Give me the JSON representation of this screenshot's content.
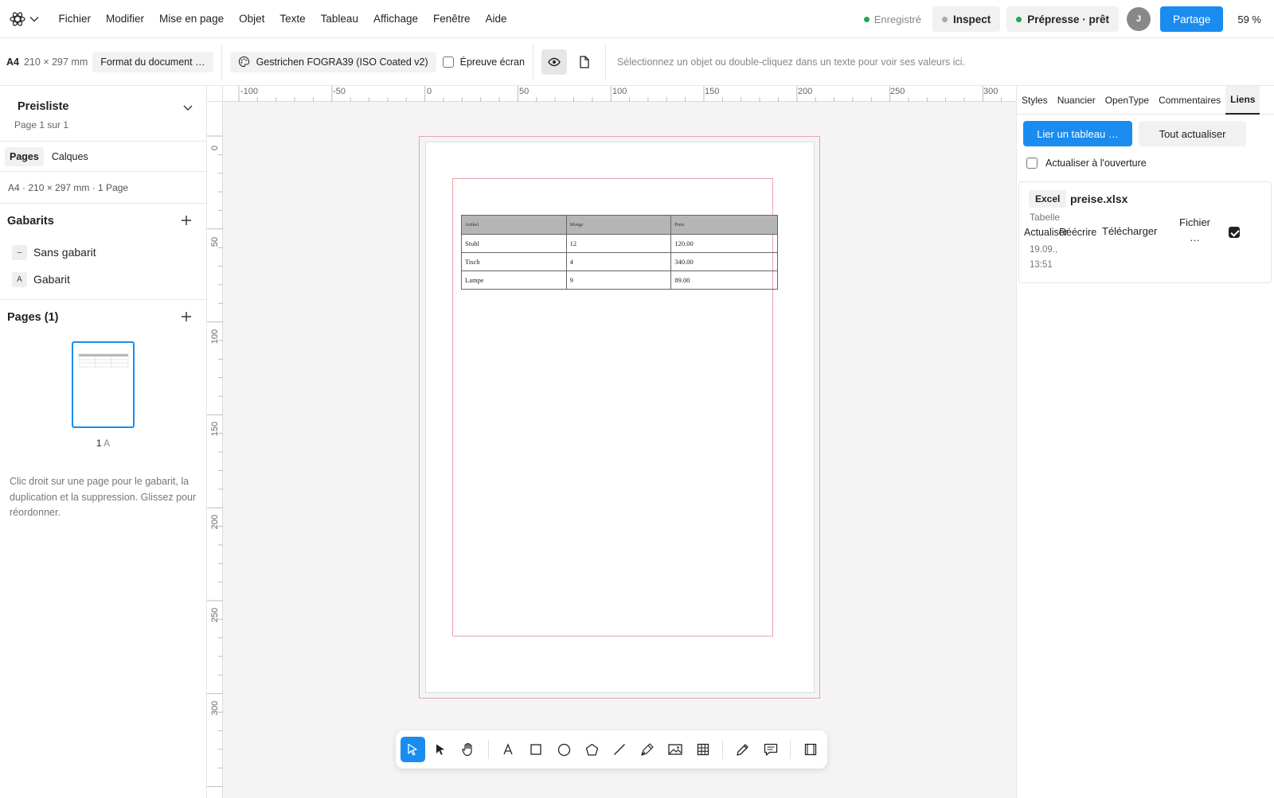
{
  "menubar": {
    "menus": [
      "Fichier",
      "Modifier",
      "Mise en page",
      "Objet",
      "Texte",
      "Tableau",
      "Affichage",
      "Fenêtre",
      "Aide"
    ],
    "status_label": "Enregistré",
    "status_color": "#22a55a",
    "inspect_label": "Inspect",
    "prepress_label": "Prépresse · prêt",
    "prepress_color": "#22a55a",
    "avatar_initial": "J",
    "share_label": "Partage",
    "zoom_label": "59 %"
  },
  "toolbar": {
    "format_code": "A4",
    "format_size": "210 × 297 mm",
    "document_format_label": "Format du document …",
    "color_profile": "Gestrichen FOGRA39 (ISO Coated v2)",
    "proof_label": "Épreuve écran",
    "hint": "Sélectionnez un objet ou double-cliquez dans un texte pour voir ses valeurs ici."
  },
  "left_panel": {
    "doc_title": "Preisliste",
    "page_counter": "Page 1 sur 1",
    "tabs": [
      "Pages",
      "Calques"
    ],
    "doc_info": "A4 · 210 × 297 mm  · 1 Page",
    "templates_title": "Gabarits",
    "templates": [
      {
        "badge": "–",
        "label": "Sans gabarit"
      },
      {
        "badge": "A",
        "label": "Gabarit"
      }
    ],
    "pages_title": "Pages (1)",
    "thumb_number": "1",
    "thumb_template": "A",
    "help_text": "Clic droit sur une page pour le gabarit, la duplication et la suppression. Glissez pour réordonner."
  },
  "rulers": {
    "horizontal": [
      "-100",
      "-50",
      "0",
      "50",
      "100",
      "150",
      "200",
      "250",
      "300"
    ],
    "vertical": [
      "0",
      "50",
      "100",
      "150",
      "200",
      "250",
      "300"
    ]
  },
  "document_table": {
    "headers": [
      "Artikel",
      "Menge",
      "Preis"
    ],
    "rows": [
      [
        "Stuhl",
        "12",
        "120.00"
      ],
      [
        "Tisch",
        "4",
        "340.00"
      ],
      [
        "Lampe",
        "9",
        "89.00"
      ]
    ]
  },
  "tools": [
    "select-icon",
    "direct-select-icon",
    "hand-icon",
    "text-icon",
    "rectangle-icon",
    "ellipse-icon",
    "polygon-icon",
    "line-icon",
    "pen-icon",
    "image-icon",
    "table-icon",
    "pencil-icon",
    "comment-icon",
    "frame-icon"
  ],
  "right_panel": {
    "tabs": [
      "Styles",
      "Nuancier",
      "OpenType",
      "Commentaires",
      "Liens"
    ],
    "link_table_label": "Lier un tableau …",
    "update_all_label": "Tout actualiser",
    "update_on_open_label": "Actualiser à l'ouverture",
    "link": {
      "type": "Excel",
      "file": "preise.xlsx",
      "sheet": "Tabelle",
      "date_line1": "19.09.,",
      "date_line2": "13:51",
      "update_label": "Actualiser",
      "rewrite_label": "Réécrire",
      "download_label": "Télécharger",
      "file_label": "Fichier",
      "more_label": "…"
    }
  },
  "colors": {
    "accent": "#1a8cf0",
    "margin_guide": "#e9a3ad",
    "table_header_bg": "#b5b5b5"
  }
}
